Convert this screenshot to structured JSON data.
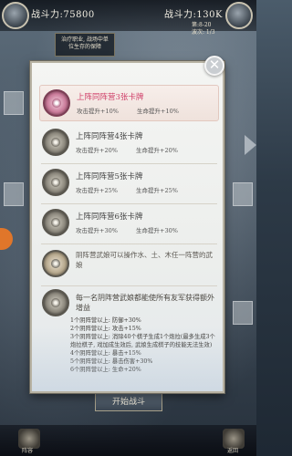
{
  "header": {
    "power_left": "战斗力:75800",
    "power_right": "战斗力:130K",
    "hint": "治疗职业, 战场中单\n位生存的保障",
    "turn": "第:8-20\n波次: 1/3"
  },
  "panel": {
    "rows": [
      {
        "title": "上阵同阵营3张卡牌",
        "atk": "攻击提升+10%",
        "hp": "生命提升+10%"
      },
      {
        "title": "上阵同阵营4张卡牌",
        "atk": "攻击提升+20%",
        "hp": "生命提升+20%"
      },
      {
        "title": "上阵同阵营5张卡牌",
        "atk": "攻击提升+25%",
        "hp": "生命提升+25%"
      },
      {
        "title": "上阵同阵营6张卡牌",
        "atk": "攻击提升+30%",
        "hp": "生命提升+30%"
      }
    ],
    "yin_desc": "阴阵营武娘可以操作水、土、木任一阵营的武娘",
    "extra_desc": "每一名阴阵营武娘都能使所有友军获得额外增益",
    "bonuses": [
      "1个阴阵营以上: 防御+30%",
      "2个阴阵营以上: 攻击+15%",
      "3个阴阵营以上: 消除40个棋子生成1个炮拉(最多生成3个炮拉棋子, 戏加成生效后, 武娘生成棋子的技能无法生效)",
      "4个阴阵营以上: 暴击+15%",
      "5个阴阵营以上: 暴击伤害+30%",
      "6个阴阵营以上: 生命+20%"
    ],
    "close_symbol": "✕"
  },
  "footer": {
    "start_button": "开始战斗",
    "left_label": "阵容",
    "right_label": "返回"
  }
}
